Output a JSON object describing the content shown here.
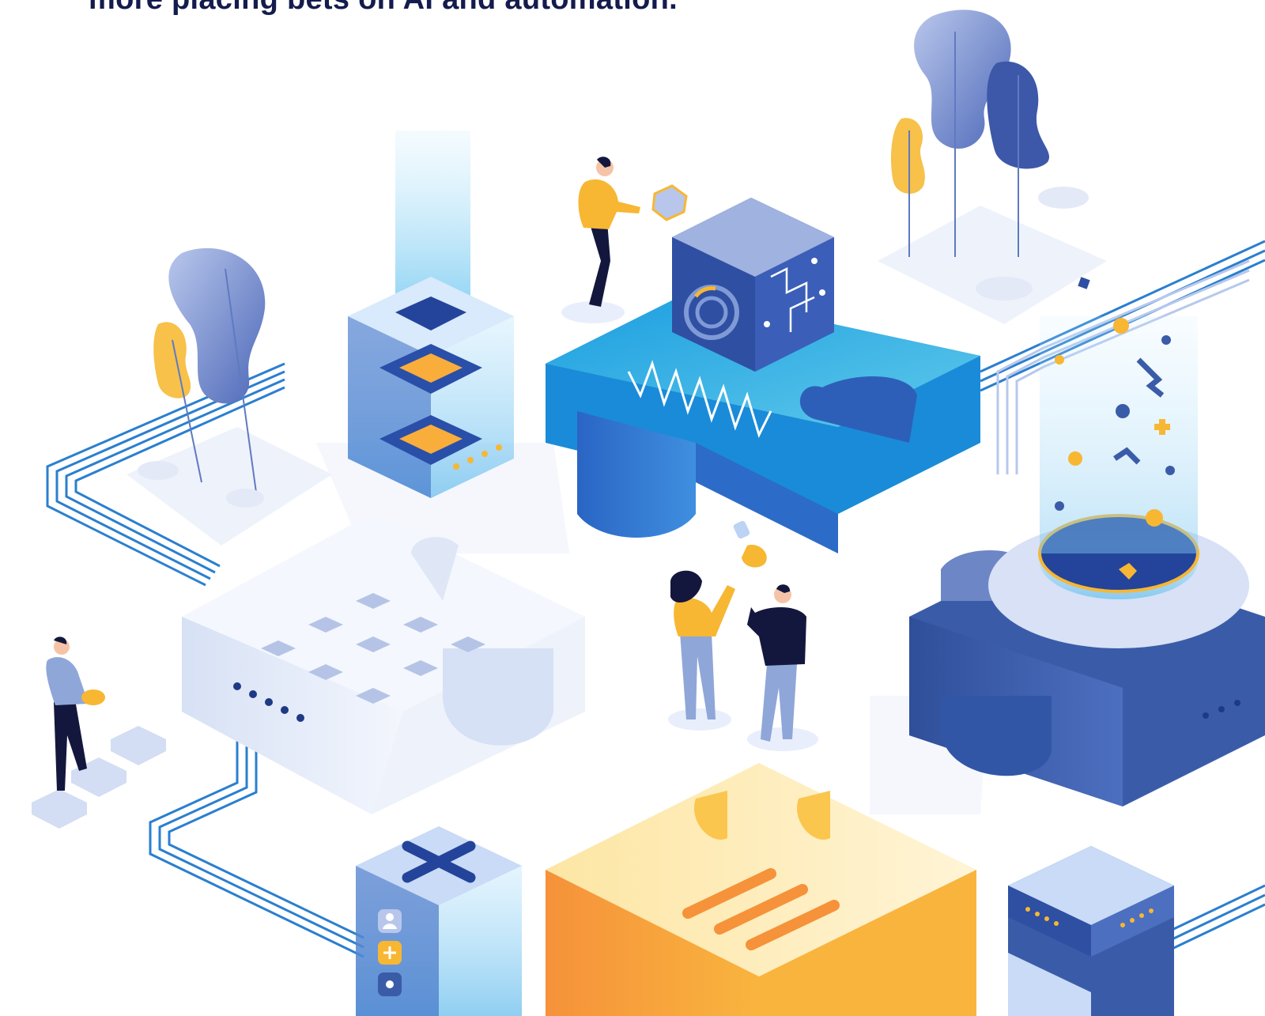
{
  "headline": {
    "text": "more placing bets on AI and automation."
  },
  "icons": {
    "chip": "ai-chip-icon",
    "keypad": "keypad-icon",
    "close": "close-icon",
    "user": "user-icon",
    "plus": "plus-icon",
    "lines": "menu-lines-icon"
  },
  "colors": {
    "navy": "#141b4d",
    "blue": "#1e5fbf",
    "light_blue": "#4fb8e6",
    "yellow": "#f7b733",
    "orange": "#f5993d",
    "pale": "#e8eefb"
  }
}
